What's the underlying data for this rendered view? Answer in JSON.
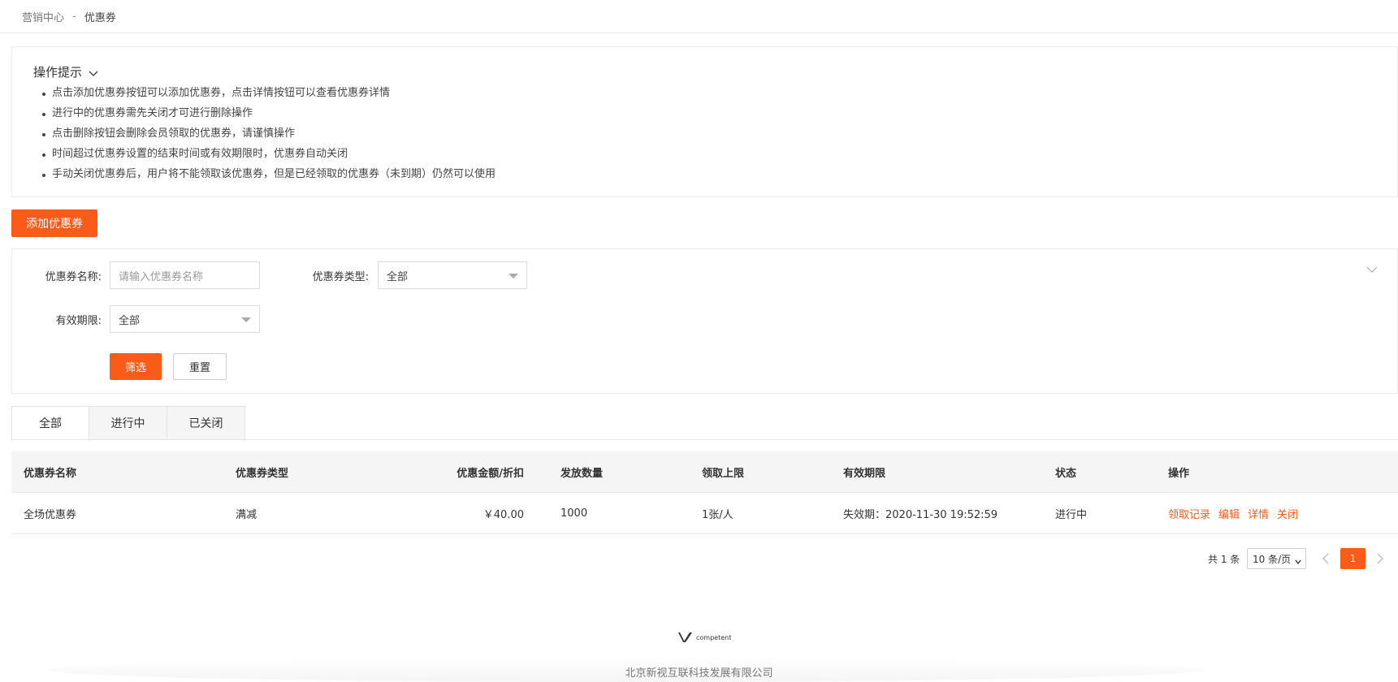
{
  "breadcrumb": {
    "parent": "营销中心",
    "separator": "-",
    "current": "优惠券"
  },
  "tips": {
    "title": "操作提示",
    "items": [
      "点击添加优惠券按钮可以添加优惠券，点击详情按钮可以查看优惠券详情",
      "进行中的优惠券需先关闭才可进行删除操作",
      "点击删除按钮会删除会员领取的优惠券，请谨慎操作",
      "时间超过优惠券设置的结束时间或有效期限时，优惠券自动关闭",
      "手动关闭优惠券后，用户将不能领取该优惠券，但是已经领取的优惠券（未到期）仍然可以使用"
    ]
  },
  "toolbar": {
    "add_label": "添加优惠券"
  },
  "filter": {
    "name_label": "优惠券名称:",
    "name_placeholder": "请输入优惠券名称",
    "type_label": "优惠券类型:",
    "type_value": "全部",
    "validity_label": "有效期限:",
    "validity_value": "全部",
    "submit_label": "筛选",
    "reset_label": "重置"
  },
  "tabs": [
    {
      "label": "全部",
      "active": true
    },
    {
      "label": "进行中",
      "active": false
    },
    {
      "label": "已关闭",
      "active": false
    }
  ],
  "table": {
    "columns": [
      "优惠券名称",
      "优惠券类型",
      "优惠金额/折扣",
      "发放数量",
      "领取上限",
      "有效期限",
      "状态",
      "操作"
    ],
    "rows": [
      {
        "name": "全场优惠券",
        "type": "满减",
        "amount": "￥40.00",
        "quantity": "1000",
        "limit": "1张/人",
        "validity": "失效期：2020-11-30 19:52:59",
        "status": "进行中",
        "actions": [
          "领取记录",
          "编辑",
          "详情",
          "关闭"
        ]
      }
    ]
  },
  "pagination": {
    "total": "共 1 条",
    "page_size": "10 条/页",
    "current_page": "1"
  },
  "footer": {
    "logo_text": "competent",
    "company": "北京新视互联科技发展有限公司"
  },
  "colors": {
    "accent": "#fb5b19",
    "border": "#ebebeb",
    "header_bg": "#f5f5f5"
  }
}
